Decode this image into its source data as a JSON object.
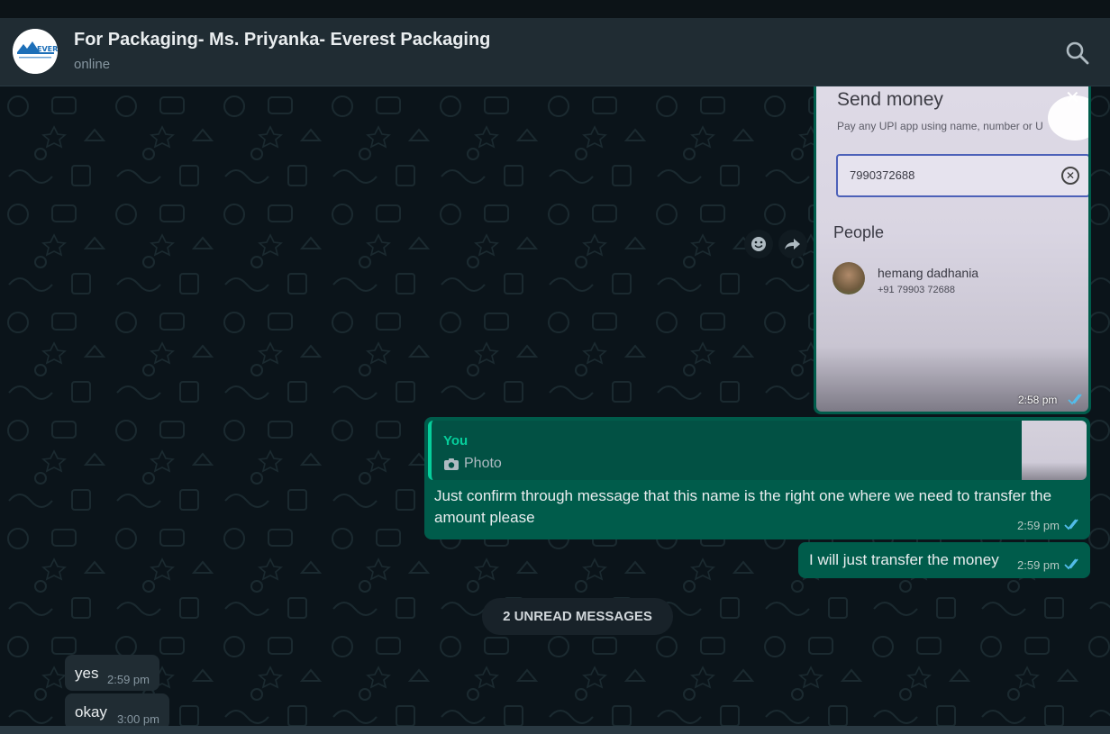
{
  "header": {
    "title": "For Packaging- Ms. Priyanka- Everest Packaging",
    "status": "online",
    "avatar_text": "EVEREST",
    "search_icon": "search-icon"
  },
  "messages": {
    "image_message": {
      "screenshot_title": "Send money",
      "screenshot_subtitle": "Pay any UPI app using name, number or U",
      "screenshot_input_value": "7990372688",
      "screenshot_section": "People",
      "screenshot_person_name": "hemang dadhania",
      "screenshot_person_phone": "+91 79903 72688",
      "time": "2:58 pm",
      "status_icon": "double-tick-read-icon"
    },
    "reply_message": {
      "quote_author": "You",
      "quote_type": "Photo",
      "text": "Just confirm through message that this name is the right one where we need to transfer the amount please",
      "time": "2:59 pm"
    },
    "short_message": {
      "text": "I will just transfer the money",
      "time": "2:59 pm"
    },
    "unread_divider": "2 UNREAD MESSAGES",
    "incoming": [
      {
        "text": "yes",
        "time": "2:59 pm"
      },
      {
        "text": "okay",
        "time": "3:00 pm"
      }
    ]
  },
  "colors": {
    "outgoing_bubble": "#005c4b",
    "incoming_bubble": "#202c33",
    "accent": "#06cf9c",
    "read_tick": "#53bdeb"
  }
}
